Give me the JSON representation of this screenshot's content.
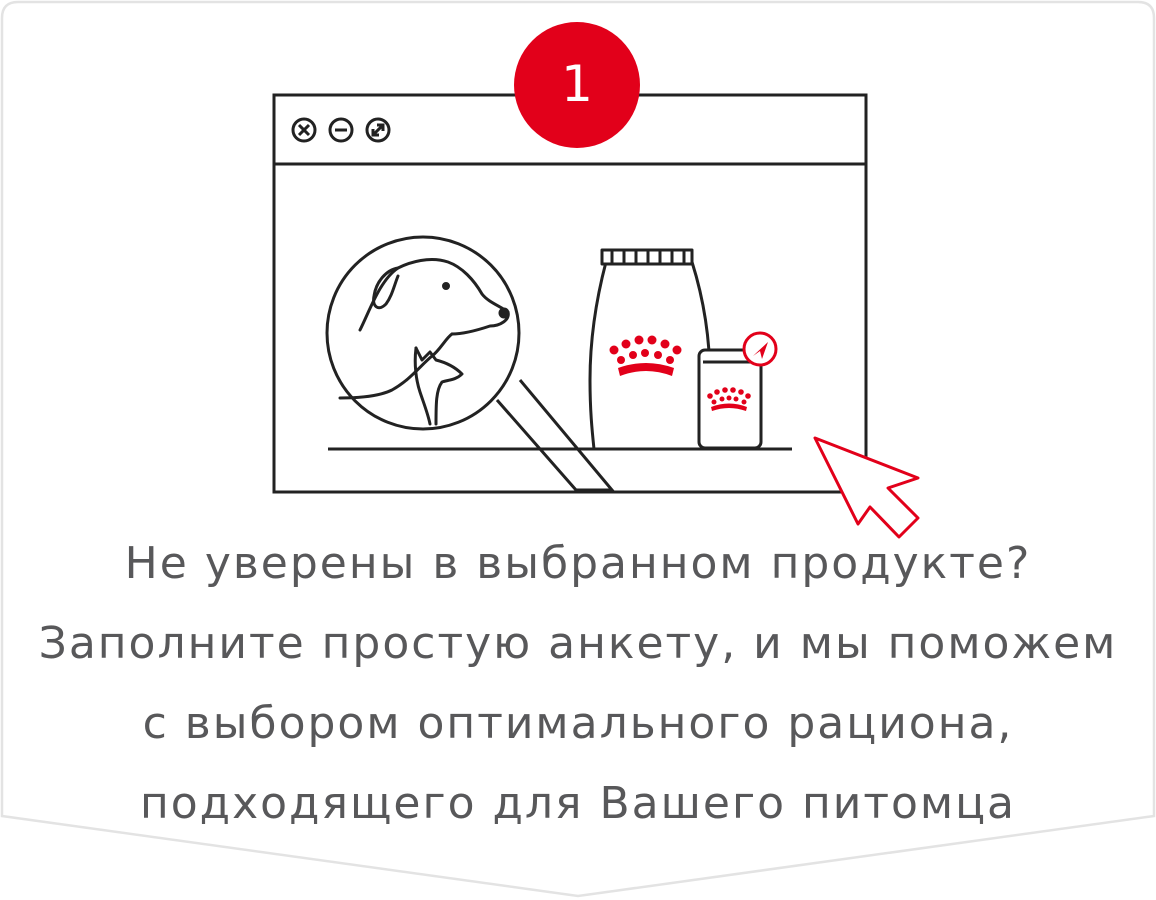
{
  "step": {
    "number": "1"
  },
  "illustration": {
    "window_controls": [
      "close-icon",
      "minimize-icon",
      "maximize-icon"
    ],
    "scene": [
      "magnifier-icon",
      "dog-icon",
      "cat-icon",
      "food-bag-icon",
      "food-pouch-icon",
      "royal-canin-crown-icon",
      "cursor-arrow-icon"
    ]
  },
  "message": {
    "lines": [
      "Не уверены в выбранном продукте?",
      "Заполните простую анкету, и мы поможем",
      "с выбором оптимального рациона,",
      "подходящего для Вашего питомца"
    ]
  },
  "colors": {
    "accent": "#e2001a",
    "text": "#58585a",
    "line_art": "#222222",
    "card_border": "#e3e3e3"
  }
}
